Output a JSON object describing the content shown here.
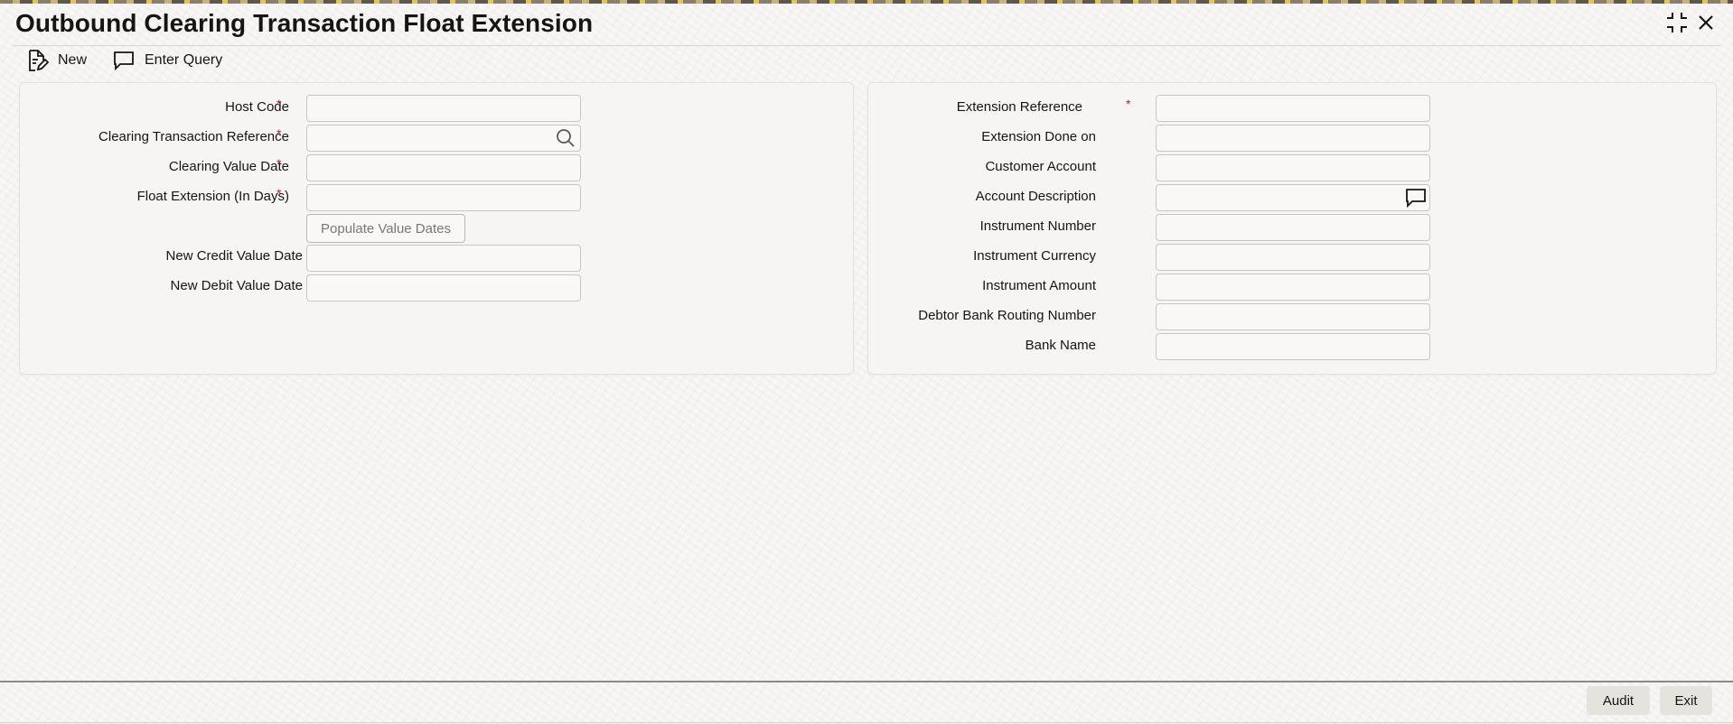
{
  "window": {
    "title": "Outbound Clearing Transaction Float Extension",
    "controls": [
      "maximize-icon",
      "close-icon"
    ]
  },
  "toolbar": {
    "new_label": "New",
    "new_icon": "new-document-icon",
    "enter_query_label": "Enter Query",
    "enter_query_icon": "speech-bubble-icon"
  },
  "left_panel": {
    "host_code": {
      "label": "Host Code",
      "required": "*",
      "value": ""
    },
    "clearing_txn_ref": {
      "label": "Clearing Transaction Reference",
      "required": "*",
      "value": "",
      "icon": "search-icon"
    },
    "clearing_value_date": {
      "label": "Clearing Value Date",
      "required": "*",
      "value": ""
    },
    "float_extension": {
      "label": "Float Extension (In Days)",
      "required": "*",
      "value": ""
    },
    "populate_button": "Populate Value Dates",
    "new_credit_value_date": {
      "label": "New Credit Value Date",
      "value": ""
    },
    "new_debit_value_date": {
      "label": "New Debit Value Date",
      "value": ""
    }
  },
  "right_panel": {
    "extension_reference": {
      "label": "Extension Reference",
      "required": "*",
      "value": ""
    },
    "extension_done_on": {
      "label": "Extension Done on",
      "value": ""
    },
    "customer_account": {
      "label": "Customer Account",
      "value": ""
    },
    "account_description": {
      "label": "Account Description",
      "value": "",
      "icon": "speech-bubble-icon"
    },
    "instrument_number": {
      "label": "Instrument Number",
      "value": ""
    },
    "instrument_currency": {
      "label": "Instrument Currency",
      "value": ""
    },
    "instrument_amount": {
      "label": "Instrument Amount",
      "value": ""
    },
    "debtor_bank_routing_number": {
      "label": "Debtor Bank Routing Number",
      "value": ""
    },
    "bank_name": {
      "label": "Bank Name",
      "value": ""
    }
  },
  "footer": {
    "audit_label": "Audit",
    "exit_label": "Exit"
  },
  "colors": {
    "required_mark": "#b3261e",
    "background": "#f7f6f4",
    "button_bg": "#e6e3de"
  }
}
